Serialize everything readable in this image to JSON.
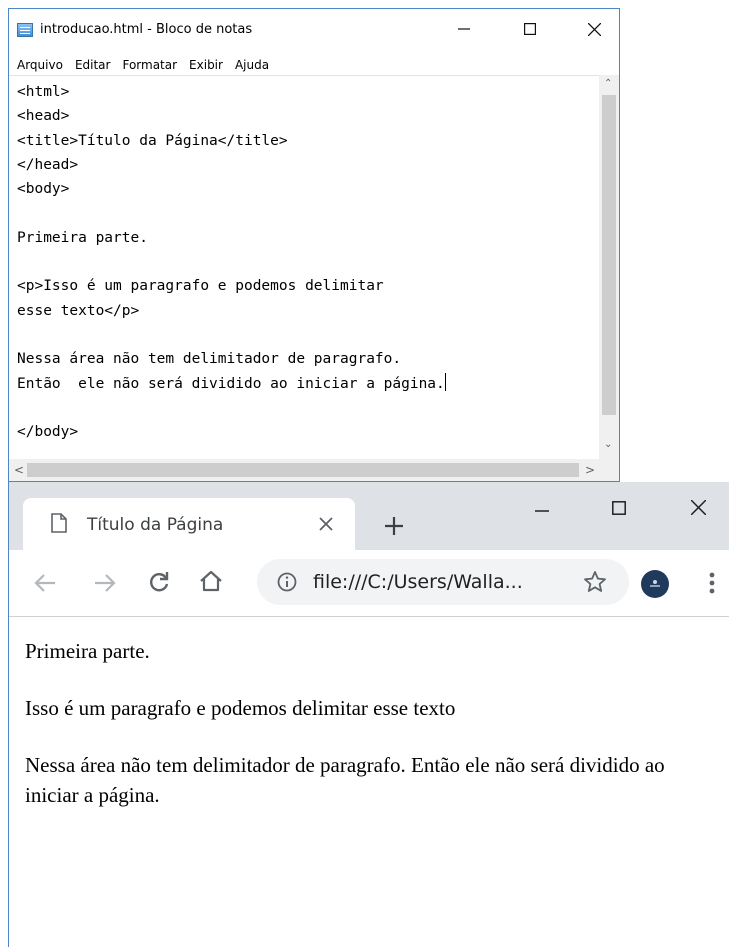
{
  "notepad": {
    "title": "introducao.html - Bloco de notas",
    "menu": [
      "Arquivo",
      "Editar",
      "Formatar",
      "Exibir",
      "Ajuda"
    ],
    "lines": [
      "<html>",
      "<head>",
      "<title>Título da Página</title>",
      "</head>",
      "<body>",
      "",
      "Primeira parte.",
      "",
      "<p>Isso é um paragrafo e podemos delimitar",
      "esse texto</p>",
      "",
      "Nessa área não tem delimitador de paragrafo.",
      "Então  ele não será dividido ao iniciar a página.",
      "",
      "</body>"
    ]
  },
  "browser": {
    "tab_title": "Título da Página",
    "url": "file:///C:/Users/Walla...",
    "paragraphs": [
      "Primeira parte.",
      "Isso é um paragrafo e podemos delimitar esse texto",
      "Nessa área não tem delimitador de paragrafo. Então ele não será dividido ao iniciar a página."
    ]
  },
  "icons": {
    "notepad_app": "notepad-app-icon",
    "minimize": "minimize-icon",
    "maximize": "maximize-icon",
    "close": "close-icon",
    "tab_page": "page-icon",
    "new_tab": "plus-icon",
    "back": "back-arrow-icon",
    "forward": "forward-arrow-icon",
    "reload": "reload-icon",
    "home": "home-icon",
    "info": "info-icon",
    "bookmark": "star-icon",
    "profile": "avatar",
    "menu": "more-vert-icon"
  }
}
